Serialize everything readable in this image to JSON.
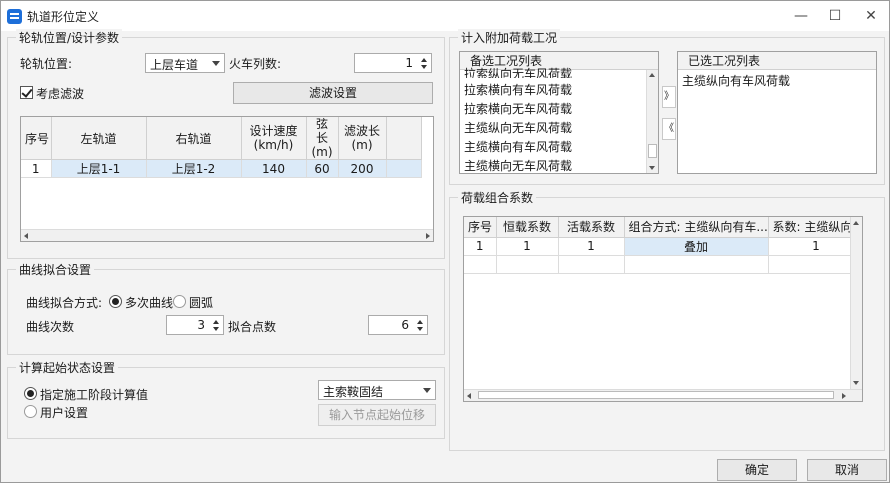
{
  "window": {
    "title": "轨道形位定义",
    "minimize": "—",
    "maximize": "☐",
    "close": "✕"
  },
  "rail": {
    "legend": "轮轨位置/设计参数",
    "position_label": "轮轨位置:",
    "position_value": "上层车道",
    "train_count_label": "火车列数:",
    "train_count_value": "1",
    "filter_checkbox_label": "考虑滤波",
    "filter_checked": true,
    "filter_button": "滤波设置",
    "columns": [
      "序号",
      "左轨道",
      "右轨道",
      "设计速度\n(km/h)",
      "弦长\n(m)",
      "滤波长\n(m)"
    ],
    "rows": [
      [
        "1",
        "上层1-1",
        "上层1-2",
        "140",
        "60",
        "200"
      ]
    ]
  },
  "curve": {
    "legend": "曲线拟合设置",
    "method_label": "曲线拟合方式:",
    "option_poly": "多次曲线",
    "option_arc": "圆弧",
    "selected": "多次曲线",
    "degree_label": "曲线次数",
    "degree_value": "3",
    "points_label": "拟合点数",
    "points_value": "6"
  },
  "initial_state": {
    "legend": "计算起始状态设置",
    "option_stage": "指定施工阶段计算值",
    "option_user": "用户设置",
    "selected": "指定施工阶段计算值",
    "stage_value": "主索鞍固结",
    "input_button": "输入节点起始位移"
  },
  "extra_load": {
    "legend": "计入附加荷载工况",
    "available_header": "备选工况列表",
    "available_items": [
      "拉索纵向无车风荷载",
      "拉索横向有车风荷载",
      "拉索横向无车风荷载",
      "主缆纵向无车风荷载",
      "主缆横向有车风荷载",
      "主缆横向无车风荷载"
    ],
    "selected_header": "已选工况列表",
    "selected_items": [
      "主缆纵向有车风荷载"
    ],
    "add_button": "》",
    "remove_button": "《"
  },
  "combo": {
    "legend": "荷载组合系数",
    "columns": [
      "序号",
      "恒载系数",
      "活载系数",
      "组合方式: 主缆纵向有车...",
      "系数: 主缆纵向..."
    ],
    "rows": [
      [
        "1",
        "1",
        "1",
        "叠加",
        "1"
      ]
    ]
  },
  "buttons": {
    "ok": "确定",
    "cancel": "取消"
  }
}
